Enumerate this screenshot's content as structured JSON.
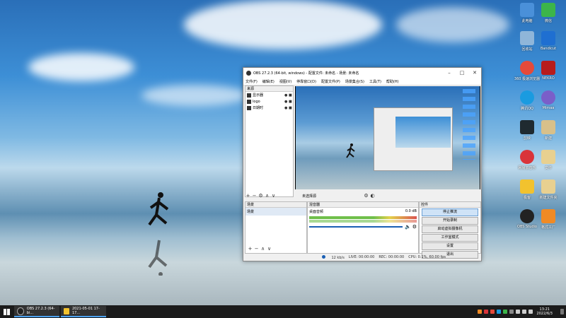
{
  "desktop": {
    "icons": [
      {
        "label": "此电脑",
        "color": "#4a90d9"
      },
      {
        "label": "微信",
        "color": "#3cb54a"
      },
      {
        "label": "回收站",
        "color": "#8fb6d9"
      },
      {
        "label": "Bandicut",
        "color": "#1f6fd1"
      },
      {
        "label": "360 极速浏览器",
        "color": "#e54a3a"
      },
      {
        "label": "NEKRO",
        "color": "#b71c1c"
      },
      {
        "label": "腾讯QQ",
        "color": "#1a9be0"
      },
      {
        "label": "Mimaa",
        "color": "#7a5fc9"
      },
      {
        "label": "剪映",
        "color": "#1f2a30"
      },
      {
        "label": "新建",
        "color": "#d8c08a"
      },
      {
        "label": "网易云音乐",
        "color": "#d9343a"
      },
      {
        "label": "文件",
        "color": "#e8d090"
      },
      {
        "label": "极客",
        "color": "#f2c22e"
      },
      {
        "label": "新建文件夹",
        "color": "#e8d090"
      },
      {
        "label": "OBS Studio",
        "color": "#222"
      },
      {
        "label": "格式工厂",
        "color": "#f08a24"
      }
    ]
  },
  "obs": {
    "title": "OBS 27.2.3 (64-bit, windows) - 配置文件: 未命名 - 场景: 未命名",
    "menu": [
      "文件(F)",
      "编辑(E)",
      "视图(V)",
      "停靠窗口(D)",
      "配置文件(P)",
      "场景集合(S)",
      "工具(T)",
      "帮助(H)"
    ],
    "scenes_header": "来源",
    "sources": [
      {
        "label": "显示器",
        "icon": "monitor-icon"
      },
      {
        "label": "logo",
        "icon": "text-icon"
      },
      {
        "label": "日期时",
        "icon": "image-icon"
      }
    ],
    "no_source_selected": "未选择源",
    "panels": {
      "scenes": {
        "title": "场景",
        "item": "场景"
      },
      "mixer": {
        "title": "混音器",
        "track": "桌面音频",
        "db": "0.0 dB"
      },
      "controls": {
        "title": "控件",
        "buttons": [
          "停止推流",
          "开始录制",
          "启动虚拟摄像机",
          "工作室模式",
          "设置",
          "退出"
        ]
      }
    },
    "status": {
      "live": "LIVE: 00:00:00",
      "rec": "REC: 00:00:00",
      "cpu": "CPU: 0.1%, 60.00 fps",
      "kbps": "12 kb/s"
    }
  },
  "taskbar": {
    "tasks": [
      {
        "label": "OBS 27.2.3 (64-bi...",
        "color": "#222"
      },
      {
        "label": "2021-05-01 17-17...",
        "color": "#f2c22e"
      }
    ],
    "time": "13:21",
    "date": "2022/6/3"
  }
}
